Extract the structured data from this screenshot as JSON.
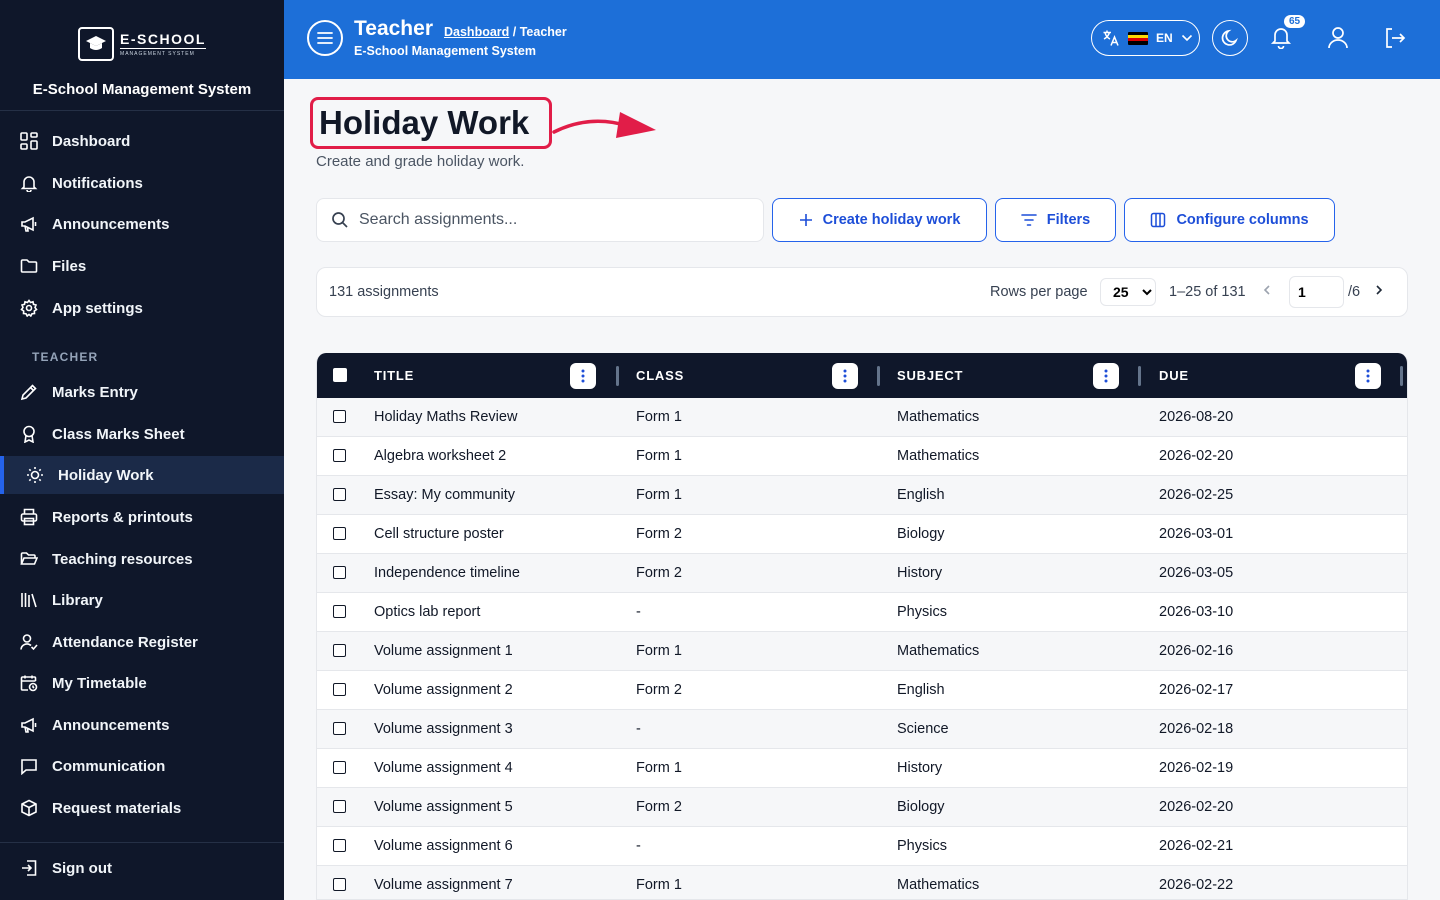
{
  "sidebar": {
    "logo_name": "E-SCHOOL",
    "logo_sub": "MANAGEMENT SYSTEM",
    "brand_title": "E-School Management System",
    "items": [
      {
        "label": "Dashboard",
        "icon": "dashboard-icon"
      },
      {
        "label": "Notifications",
        "icon": "bell-icon"
      },
      {
        "label": "Announcements",
        "icon": "megaphone-icon"
      },
      {
        "label": "Files",
        "icon": "folder-icon"
      },
      {
        "label": "App settings",
        "icon": "gear-icon"
      }
    ],
    "section_label": "TEACHER",
    "teacher_items": [
      {
        "label": "Marks Entry",
        "icon": "pencil-icon"
      },
      {
        "label": "Class Marks Sheet",
        "icon": "award-icon"
      },
      {
        "label": "Holiday Work",
        "icon": "sun-icon",
        "active": true
      },
      {
        "label": "Reports & printouts",
        "icon": "printer-icon"
      },
      {
        "label": "Teaching resources",
        "icon": "folder-open-icon"
      },
      {
        "label": "Library",
        "icon": "library-icon"
      },
      {
        "label": "Attendance Register",
        "icon": "user-check-icon"
      },
      {
        "label": "My Timetable",
        "icon": "calendar-clock-icon"
      },
      {
        "label": "Announcements",
        "icon": "megaphone-icon"
      },
      {
        "label": "Communication",
        "icon": "message-icon"
      },
      {
        "label": "Request materials",
        "icon": "box-icon"
      }
    ],
    "sign_out": "Sign out"
  },
  "header": {
    "title": "Teacher",
    "breadcrumb_link": "Dashboard",
    "breadcrumb_sep": " / ",
    "breadcrumb_current": "Teacher",
    "subtitle": "E-School Management System",
    "language": "EN",
    "notification_count": "65"
  },
  "page": {
    "title": "Holiday Work",
    "description": "Create and grade holiday work."
  },
  "search": {
    "placeholder": "Search assignments..."
  },
  "actions": {
    "create": "Create holiday work",
    "filters": "Filters",
    "configure": "Configure columns"
  },
  "pagination": {
    "count": "131 assignments",
    "rows_per_page_label": "Rows per page",
    "rows_per_page": "25",
    "range": "1–25 of 131",
    "page": "1",
    "total_pages": "/6"
  },
  "table": {
    "columns": [
      "TITLE",
      "CLASS",
      "SUBJECT",
      "DUE"
    ],
    "rows": [
      [
        "Holiday Maths Review",
        "Form 1",
        "Mathematics",
        "2026-08-20"
      ],
      [
        "Algebra worksheet 2",
        "Form 1",
        "Mathematics",
        "2026-02-20"
      ],
      [
        "Essay: My community",
        "Form 1",
        "English",
        "2026-02-25"
      ],
      [
        "Cell structure poster",
        "Form 2",
        "Biology",
        "2026-03-01"
      ],
      [
        "Independence timeline",
        "Form 2",
        "History",
        "2026-03-05"
      ],
      [
        "Optics lab report",
        "-",
        "Physics",
        "2026-03-10"
      ],
      [
        "Volume assignment 1",
        "Form 1",
        "Mathematics",
        "2026-02-16"
      ],
      [
        "Volume assignment 2",
        "Form 2",
        "English",
        "2026-02-17"
      ],
      [
        "Volume assignment 3",
        "-",
        "Science",
        "2026-02-18"
      ],
      [
        "Volume assignment 4",
        "Form 1",
        "History",
        "2026-02-19"
      ],
      [
        "Volume assignment 5",
        "Form 2",
        "Biology",
        "2026-02-20"
      ],
      [
        "Volume assignment 6",
        "-",
        "Physics",
        "2026-02-21"
      ],
      [
        "Volume assignment 7",
        "Form 1",
        "Mathematics",
        "2026-02-22"
      ]
    ]
  },
  "colors": {
    "header": "#1d6fd8",
    "sidebar": "#0f172a",
    "accent": "#2563eb",
    "highlight": "#e11d48"
  }
}
